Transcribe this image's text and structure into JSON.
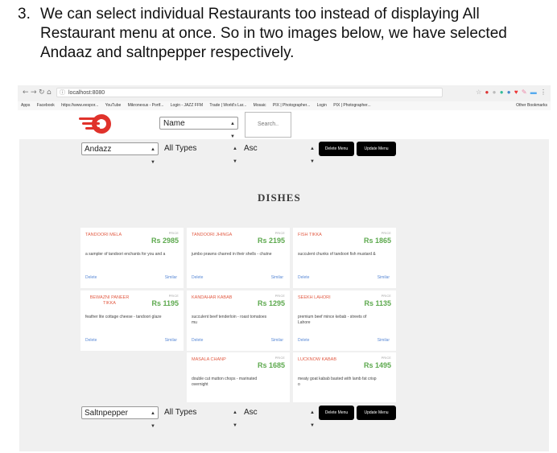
{
  "intro": {
    "number": "3.",
    "text": "We can select individual Restaurants too instead of displaying All Restaurant menu at once. So in two images below, we have selected Andaaz and saltnpepper respectively."
  },
  "browser": {
    "address": "localhost:8080",
    "bookmarks": [
      "Apps",
      "Facebook",
      "https://www.eespor...",
      "YouTube",
      "Mikronexus - Portf...",
      "Login - JAZZ FFM",
      "Trade | World's Lar...",
      "Mosaic",
      "PIX | Photographer...",
      "Login",
      "PIX | Photographer..."
    ],
    "other_bookmarks": "Other Bookmarks"
  },
  "header": {
    "sort_select": "Name",
    "search_placeholder": "Search.."
  },
  "top_controls": {
    "restaurant": "Andazz",
    "type": "All Types",
    "order": "Asc",
    "delete_btn": "Delete Menu",
    "update_btn": "Update Menu"
  },
  "section_title": "DISHES",
  "price_label": "PRICE",
  "delete_label": "Delete",
  "similar_label": "Similar",
  "cards": [
    {
      "name": "TANDOORI MELA",
      "price": "Rs 2985",
      "desc": "a sampler of tandoori enchants for you and a"
    },
    {
      "name": "TANDOORI JHINGA",
      "price": "Rs 2195",
      "desc": "jumbo prawns charred in their shells - chutne"
    },
    {
      "name": "FISH TIKKA",
      "price": "Rs 1865",
      "desc": "succulent chunks of tandoori fish mustard &"
    },
    {
      "name": "BEWAZNI PANEER TIKKA",
      "price": "Rs 1195",
      "desc": "feather lite cottage cheese - tandoori glaze"
    },
    {
      "name": "KANDAHAR KABAB",
      "price": "Rs 1295",
      "desc": "succulent beef tenderloin - roast tomatoes mu"
    },
    {
      "name": "SEEKH LAHORI",
      "price": "Rs 1135",
      "desc": "premium beef mince kebab - streets of Lahore"
    },
    {
      "name": "MASALA CHANP",
      "price": "Rs 1685",
      "desc": "double cut mutton chops - marinated overnight"
    },
    {
      "name": "LUCKNOW KABAB",
      "price": "Rs 1495",
      "desc": "meaty goat kabab basted with lamb fat crisp o"
    }
  ],
  "bottom_controls": {
    "restaurant": "Saltnpepper",
    "type": "All Types",
    "order": "Asc",
    "delete_btn": "Delete Menu",
    "update_btn": "Update Menu"
  },
  "colors": {
    "dish_name": "#e25c45",
    "price": "#5da94e",
    "link": "#5b8ad6",
    "button": "#000000",
    "panel": "#f0f0f0"
  }
}
